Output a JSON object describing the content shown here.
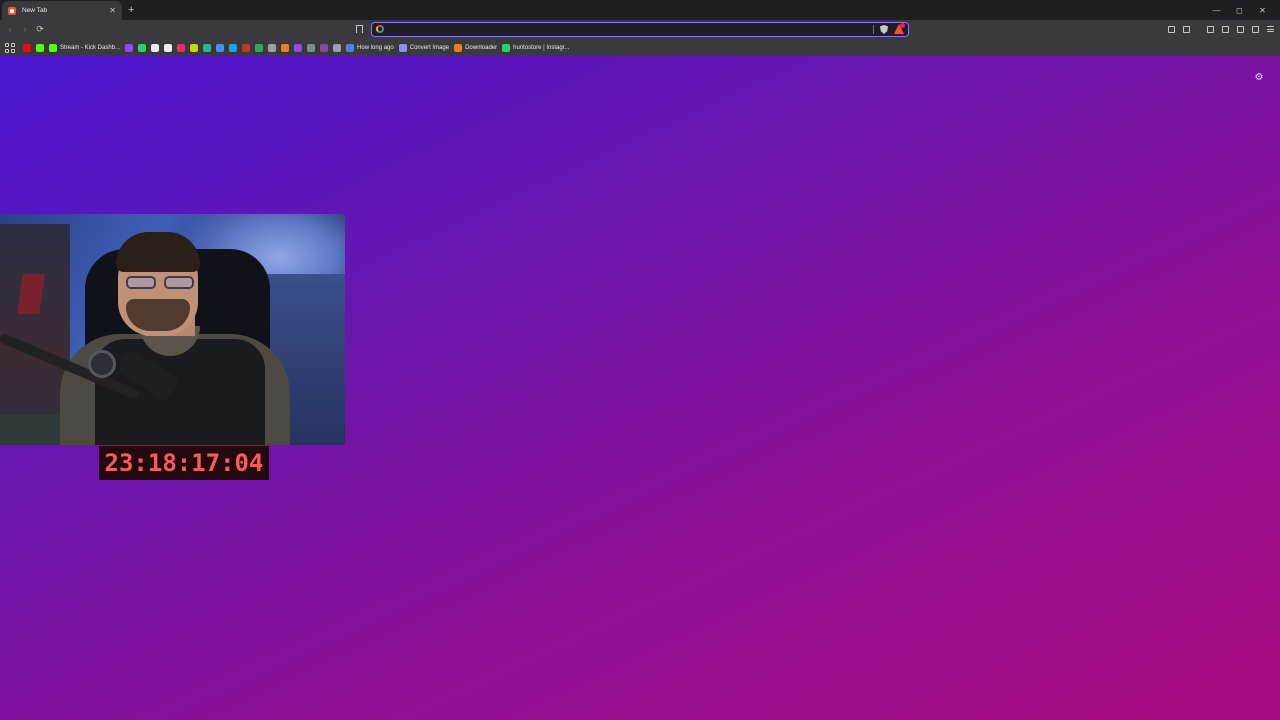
{
  "tab": {
    "title": "New Tab",
    "close": "✕"
  },
  "new_tab": "+",
  "window_controls": {
    "minimize": "—",
    "maximize": "◻",
    "close": "✕"
  },
  "nav": {
    "back": "‹",
    "forward": "›",
    "reload": "⟳"
  },
  "urlbar": {
    "value": "",
    "placeholder": ""
  },
  "bookmarks": [
    {
      "icon": "youtube-icon",
      "color": "#ff0000",
      "label": ""
    },
    {
      "icon": "kick-icon",
      "color": "#53fc18",
      "label": ""
    },
    {
      "icon": "kick-icon",
      "color": "#53fc18",
      "label": "Stream - Kick Dashb..."
    },
    {
      "icon": "twitch-icon",
      "color": "#9146ff",
      "label": ""
    },
    {
      "icon": "whatsapp-icon",
      "color": "#25d366",
      "label": ""
    },
    {
      "icon": "x-icon",
      "color": "#e8eaed",
      "label": ""
    },
    {
      "icon": "tiktok-icon",
      "color": "#e8eaed",
      "label": ""
    },
    {
      "icon": "instagram-icon",
      "color": "#e1306c",
      "label": ""
    },
    {
      "icon": "bookmark-icon",
      "color": "#c7d600",
      "label": ""
    },
    {
      "icon": "bookmark-icon",
      "color": "#2bb3a0",
      "label": ""
    },
    {
      "icon": "bookmark-icon",
      "color": "#4c8bf5",
      "label": ""
    },
    {
      "icon": "bookmark-icon",
      "color": "#1da1f2",
      "label": ""
    },
    {
      "icon": "bookmark-icon",
      "color": "#c0392b",
      "label": ""
    },
    {
      "icon": "bookmark-icon",
      "color": "#27ae60",
      "label": ""
    },
    {
      "icon": "bookmark-icon",
      "color": "#9e9e9e",
      "label": ""
    },
    {
      "icon": "bookmark-icon",
      "color": "#e67e22",
      "label": ""
    },
    {
      "icon": "bookmark-icon",
      "color": "#9146ff",
      "label": ""
    },
    {
      "icon": "bookmark-icon",
      "color": "#7f8c8d",
      "label": ""
    },
    {
      "icon": "bookmark-icon",
      "color": "#8e44ad",
      "label": ""
    },
    {
      "icon": "bookmark-icon",
      "color": "#95a5a6",
      "label": ""
    },
    {
      "icon": "bookmark-icon",
      "color": "#5b7be8",
      "label": "How long ago"
    },
    {
      "icon": "bookmark-icon",
      "color": "#8e8ef5",
      "label": "Convert Image"
    },
    {
      "icon": "bookmark-icon",
      "color": "#e67e22",
      "label": "Downloader"
    },
    {
      "icon": "bookmark-icon",
      "color": "#2ecc71",
      "label": "huntostore | Instagr..."
    }
  ],
  "timer": {
    "value": "23:18:17:04"
  },
  "colors": {
    "accent": "#8a71ff",
    "timer": "#ff5a5a",
    "gradient_start": "#4a16cf",
    "gradient_end": "#a80b80"
  }
}
